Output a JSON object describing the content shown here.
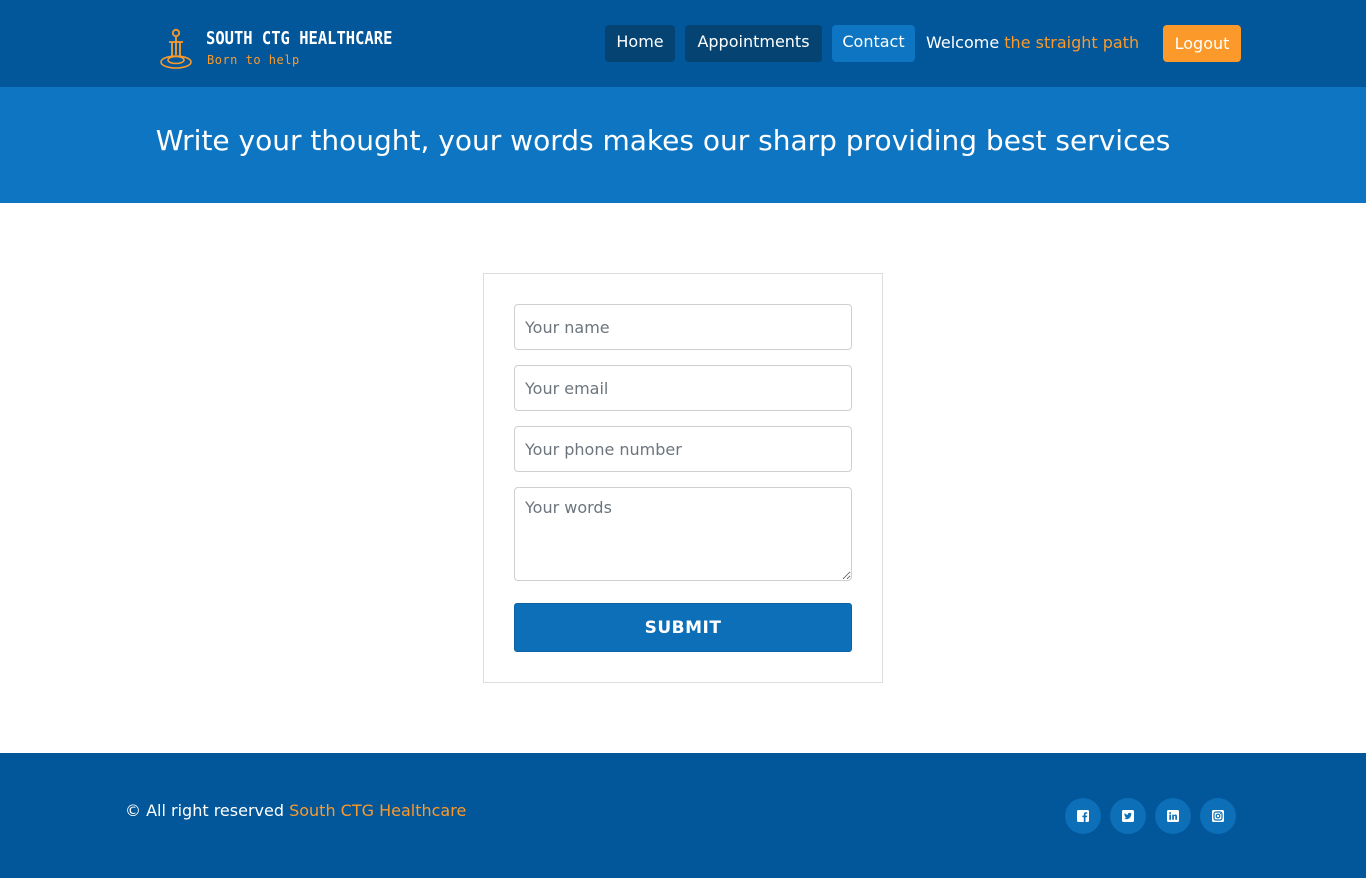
{
  "brand": {
    "name": "SOUTH CTG HEALTHCARE",
    "tagline": "Born to help",
    "accent_color": "#fb9a2b",
    "primary_color": "#02569a"
  },
  "nav": {
    "home": "Home",
    "appointments": "Appointments",
    "contact": "Contact",
    "active": "Contact",
    "welcome_prefix": "Welcome",
    "username": "the straight path",
    "logout": "Logout"
  },
  "banner": {
    "heading": "Write your thought, your words makes our sharp providing best services"
  },
  "form": {
    "name_placeholder": "Your name",
    "email_placeholder": "Your email",
    "phone_placeholder": "Your phone number",
    "words_placeholder": "Your words",
    "submit_label": "SUBMIT"
  },
  "footer": {
    "copyright_prefix": "© All right reserved",
    "copyright_brand": "South CTG Healthcare",
    "social": [
      "facebook-icon",
      "twitter-icon",
      "linkedin-icon",
      "instagram-icon"
    ]
  }
}
